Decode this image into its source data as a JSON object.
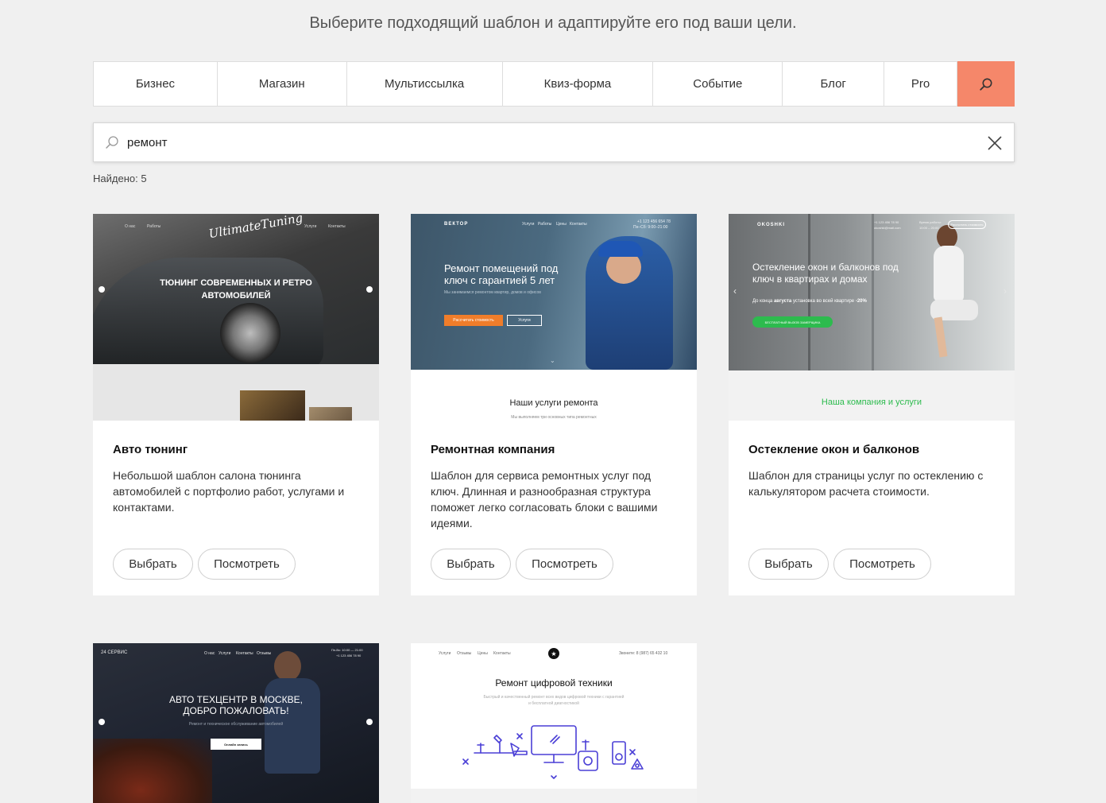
{
  "subtitle": "Выберите подходящий шаблон и адаптируйте его под ваши цели.",
  "categories": [
    "Бизнес",
    "Магазин",
    "Мультиссылка",
    "Квиз-форма",
    "Событие",
    "Блог",
    "Pro"
  ],
  "search": {
    "value": "ремонт"
  },
  "found": "Найдено: 5",
  "buttons": {
    "select": "Выбрать",
    "view": "Посмотреть"
  },
  "colors": {
    "accent": "#f5876a",
    "green": "#2dbb4e",
    "orange": "#f07d2a"
  },
  "cards": [
    {
      "title": "Авто тюнинг",
      "desc": "Небольшой шаблон салона тюнинга автомобилей с портфолио работ, услугами и контактами.",
      "preview": {
        "logo": "UltimateTuning",
        "menu": [
          "О нас",
          "Работы",
          "Услуги",
          "Контакты"
        ],
        "headline": "ТЮНИНГ СОВРЕМЕННЫХ И РЕТРО АВТОМОБИЛЕЙ"
      }
    },
    {
      "title": "Ремонтная компания",
      "desc": "Шаблон для сервиса ремонтных услуг под ключ. Длинная и разнообразная структура поможет легко согласовать блоки с вашими идеями.",
      "preview": {
        "logo": "ВЕКТОР",
        "menu": [
          "Услуги",
          "Работы",
          "Цены",
          "Контакты"
        ],
        "phone": "+1 123 456 654 78",
        "hours": "Пн–Сб: 9:00–21:00",
        "headline": "Ремонт помещений под ключ с гарантией 5 лет",
        "sub": "Мы занимаемся ремонтом квартир, домов и офисов",
        "btn1": "Рассчитать стоимость",
        "btn2": "Услуги",
        "section": "Наши услуги ремонта",
        "section_sub": "Мы выполняем три основных типа ремонтных"
      }
    },
    {
      "title": "Остекление окон и балконов",
      "desc": "Шаблон для страницы услуг по остеклению с калькулятором расчета стоимости.",
      "preview": {
        "logo": "OKOSHKI",
        "phone": "+1 123 456 78 90",
        "email": "okoshki@mail.com",
        "hours_label": "Время работы:",
        "hours": "10:00 – 20:00",
        "callback": "Рассчитать стоимость",
        "headline": "Остекление окон и балконов под ключ в квартирах и домах",
        "promo_pre": "До конца",
        "promo_month": "августа",
        "promo_post": "установка во всей квартире",
        "promo_pct": "-20%",
        "cta": "БЕСПЛАТНЫЙ ВЫЗОВ ЗАМЕРЩИКА",
        "section": "Наша компания и услуги"
      }
    },
    {
      "preview": {
        "logo": "24 СЕРВИС",
        "menu": [
          "О нас",
          "Услуги",
          "Контакты",
          "Отзывы"
        ],
        "hours": "Пн-Вс: 10:00 — 21:00",
        "phone": "+1 123 456 78 90",
        "headline": "АВТО ТЕХЦЕНТР В МОСКВЕ, ДОБРО ПОЖАЛОВАТЬ!",
        "sub": "Ремонт и техническое обслуживание автомобилей",
        "btn": "Онлайн запись"
      }
    },
    {
      "preview": {
        "menu": [
          "Услуги",
          "Отзывы",
          "Цены",
          "Контакты"
        ],
        "phone": "Звоните: 8 (987) 65 432 10",
        "headline": "Ремонт цифровой техники",
        "sub": "Быстрый и качественный ремонт всех видов цифровой техники с гарантией и бесплатной диагностикой"
      }
    }
  ]
}
